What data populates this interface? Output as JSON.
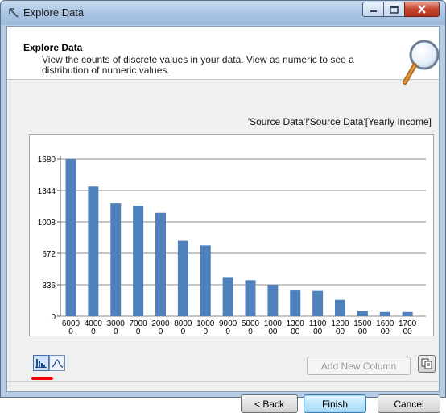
{
  "window": {
    "title": "Explore Data"
  },
  "header": {
    "title": "Explore Data",
    "description": "View the counts of discrete values in your data.  View as numeric to see a distribution of numeric values."
  },
  "chart_caption": "'Source Data'!'Source Data'[Yearly Income]",
  "chart_data": {
    "type": "bar",
    "categories": [
      "60000",
      "40000",
      "30000",
      "70000",
      "20000",
      "80000",
      "10000",
      "90000",
      "50000",
      "100000",
      "130000",
      "110000",
      "120000",
      "150000",
      "160000",
      "170000"
    ],
    "tick_labels": [
      [
        "6000",
        "0"
      ],
      [
        "4000",
        "0"
      ],
      [
        "3000",
        "0"
      ],
      [
        "7000",
        "0"
      ],
      [
        "2000",
        "0"
      ],
      [
        "8000",
        "0"
      ],
      [
        "1000",
        "0"
      ],
      [
        "9000",
        "0"
      ],
      [
        "5000",
        "0"
      ],
      [
        "1000",
        "00"
      ],
      [
        "1300",
        "00"
      ],
      [
        "1100",
        "00"
      ],
      [
        "1200",
        "00"
      ],
      [
        "1500",
        "00"
      ],
      [
        "1600",
        "00"
      ],
      [
        "1700",
        "00"
      ]
    ],
    "values": [
      1680,
      1385,
      1205,
      1180,
      1105,
      805,
      755,
      410,
      385,
      335,
      275,
      270,
      175,
      55,
      45,
      45
    ],
    "yticks": [
      0,
      336,
      672,
      1008,
      1344,
      1680
    ],
    "ylim": [
      0,
      1680
    ],
    "grid": true,
    "bar_color": "#4f81bd"
  },
  "toolbar": {
    "histogram_icon": "histogram-icon",
    "distribution_icon": "distribution-curve-icon",
    "add_column_label": "Add New Column",
    "copy_icon": "copy-icon"
  },
  "buttons": {
    "back": "< Back",
    "finish": "Finish",
    "cancel": "Cancel"
  },
  "colors": {
    "accent": "#4f81bd",
    "highlight": "#ff0000"
  }
}
